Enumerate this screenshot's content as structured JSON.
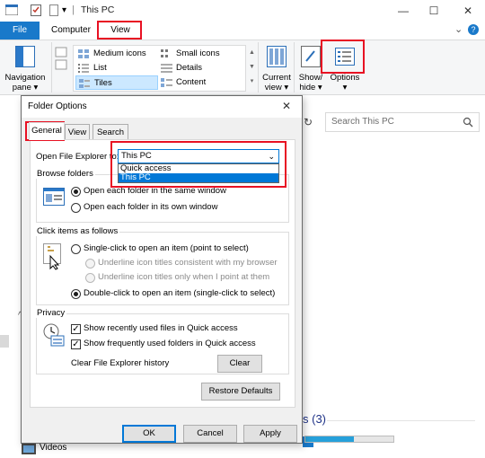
{
  "window": {
    "title": "This PC",
    "quick_access_separator": "|",
    "minimize_glyph": "—",
    "maximize_glyph": "☐",
    "close_glyph": "✕",
    "help_glyph": "?",
    "collapse_glyph": "⌄"
  },
  "ribbon": {
    "tabs": [
      {
        "label": "File"
      },
      {
        "label": "Computer"
      },
      {
        "label": "View"
      }
    ],
    "navigation_pane": {
      "line1": "Navigation",
      "line2": "pane ▾"
    },
    "layout_items": [
      {
        "label": "Medium icons"
      },
      {
        "label": "Small icons"
      },
      {
        "label": "List"
      },
      {
        "label": "Details"
      },
      {
        "label": "Tiles"
      },
      {
        "label": "Content"
      }
    ],
    "current_view": {
      "line1": "Current",
      "line2": "view ▾"
    },
    "show_hide": {
      "line1": "Show/",
      "line2": "hide ▾"
    },
    "options": {
      "label": "Options",
      "arrow": "▾"
    }
  },
  "explorer": {
    "search_placeholder": "Search This PC",
    "refresh_glyph": "↻",
    "section_partial": "s (3)",
    "sidebar_videos": "Videos",
    "sidebar_marker": "^"
  },
  "dialog": {
    "title": "Folder Options",
    "close_glyph": "✕",
    "tabs": [
      {
        "label": "General"
      },
      {
        "label": "View"
      },
      {
        "label": "Search"
      }
    ],
    "open_explorer_label": "Open File Explorer to:",
    "open_explorer_value": "This PC",
    "dropdown_options": [
      {
        "label": "Quick access"
      },
      {
        "label": "This PC"
      }
    ],
    "browse_folders": {
      "title": "Browse folders",
      "opt1": "Open each folder in the same window",
      "opt2": "Open each folder in its own window"
    },
    "click_items": {
      "title": "Click items as follows",
      "single": "Single-click to open an item (point to select)",
      "underline_consistent": "Underline icon titles consistent with my browser",
      "underline_point": "Underline icon titles only when I point at them",
      "double": "Double-click to open an item (single-click to select)"
    },
    "privacy": {
      "title": "Privacy",
      "recent_files": "Show recently used files in Quick access",
      "frequent_folders": "Show frequently used folders in Quick access",
      "clear_history_label": "Clear File Explorer history",
      "clear_button": "Clear"
    },
    "restore_defaults": "Restore Defaults",
    "ok": "OK",
    "cancel": "Cancel",
    "apply": "Apply"
  },
  "colors": {
    "accent": "#0078d7",
    "file_tab": "#1979ca",
    "highlight_box": "#e81123"
  }
}
